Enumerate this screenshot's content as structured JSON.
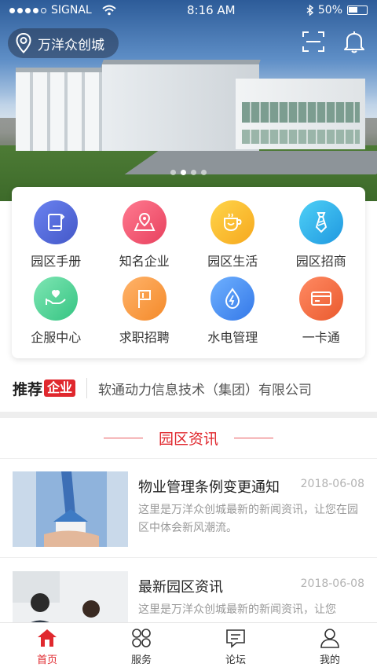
{
  "status_bar": {
    "carrier": "SIGNAL",
    "time": "8:16 AM",
    "battery": "50%",
    "battery_level": 0.5,
    "signal_bars": 4
  },
  "header": {
    "location": "万洋众创城",
    "scan_icon": "scan-icon",
    "bell_icon": "bell-icon"
  },
  "carousel": {
    "count": 4,
    "active_index": 1
  },
  "menu": [
    {
      "label": "园区手册",
      "icon": "handbook-icon",
      "color": "#4f67d6"
    },
    {
      "label": "知名企业",
      "icon": "map-pin-icon",
      "color": "#f0506e"
    },
    {
      "label": "园区生活",
      "icon": "cup-icon",
      "color": "#f8b72a"
    },
    {
      "label": "园区招商",
      "icon": "tie-icon",
      "color": "#29a7e8"
    },
    {
      "label": "企服中心",
      "icon": "hand-heart-icon",
      "color": "#3fcf8e"
    },
    {
      "label": "求职招聘",
      "icon": "flag-icon",
      "color": "#f79533"
    },
    {
      "label": "水电管理",
      "icon": "water-drop-icon",
      "color": "#3f8ff0"
    },
    {
      "label": "一卡通",
      "icon": "card-icon",
      "color": "#f1623b"
    }
  ],
  "recommend": {
    "title": "推荐",
    "badge": "企业",
    "text": "软通动力信息技术（集团）有限公司"
  },
  "news_section": {
    "title": "园区资讯"
  },
  "news": [
    {
      "title": "物业管理条例变更通知",
      "date": "2018-06-08",
      "desc": "这里是万洋众创城最新的新闻资讯，让您在园区中体会新风潮流。"
    },
    {
      "title": "最新园区资讯",
      "date": "2018-06-08",
      "desc": "这里是万洋众创城最新的新闻资讯，让您"
    }
  ],
  "tabs": [
    {
      "label": "首页",
      "icon": "home-icon",
      "active": true
    },
    {
      "label": "服务",
      "icon": "grid-icon",
      "active": false
    },
    {
      "label": "论坛",
      "icon": "chat-icon",
      "active": false
    },
    {
      "label": "我的",
      "icon": "user-icon",
      "active": false
    }
  ],
  "colors": {
    "accent": "#e0282e"
  }
}
